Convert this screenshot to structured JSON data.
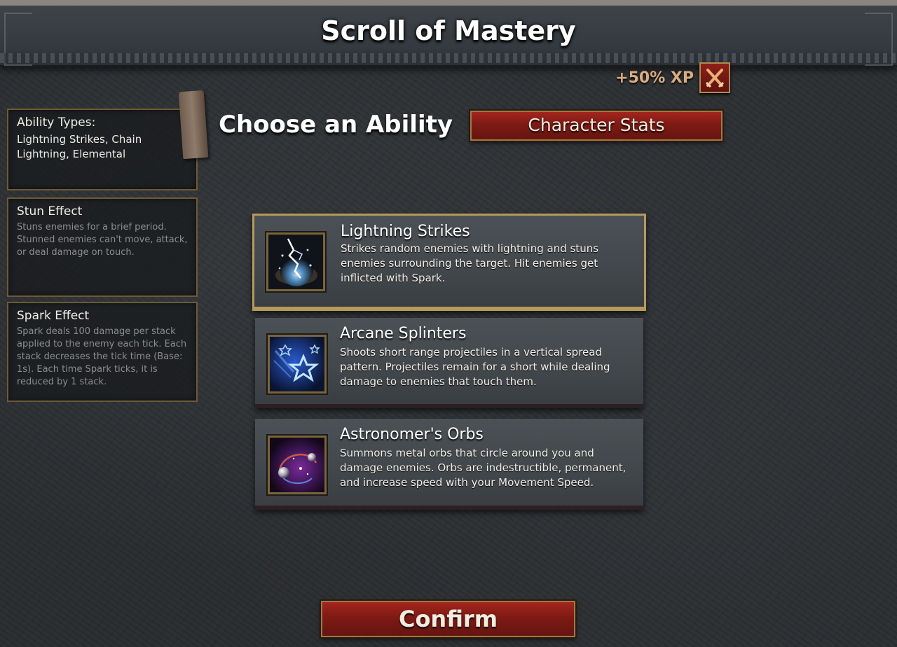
{
  "header": {
    "title": "Scroll of Mastery"
  },
  "xp_bonus": {
    "label": "+50% XP",
    "icon": "crossed-swords-icon"
  },
  "sidebar": {
    "ability_types": {
      "title": "Ability Types:",
      "value": "Lightning Strikes, Chain Lightning, Elemental"
    },
    "stun_effect": {
      "title": "Stun Effect",
      "description": "Stuns enemies for a brief period. Stunned enemies can't move, attack, or deal damage on touch."
    },
    "spark_effect": {
      "title": "Spark Effect",
      "description": "Spark deals 100 damage per stack applied to the enemy each tick. Each stack decreases the tick time (Base: 1s). Each time Spark ticks, it is reduced by 1 stack."
    }
  },
  "main": {
    "heading": "Choose an Ability",
    "stats_button_label": "Character Stats",
    "abilities": [
      {
        "name": "Lightning Strikes",
        "description": "Strikes random enemies with lightning and stuns enemies surrounding the target. Hit enemies get inflicted with Spark.",
        "icon": "lightning-strike-icon",
        "selected": true
      },
      {
        "name": "Arcane Splinters",
        "description": "Shoots short range projectiles in a vertical spread pattern. Projectiles remain for a short while dealing damage to enemies that touch them.",
        "icon": "arcane-splinters-icon",
        "selected": false
      },
      {
        "name": "Astronomer's Orbs",
        "description": "Summons metal orbs that circle around you and damage enemies. Orbs are indestructible, permanent, and increase speed with your Movement Speed.",
        "icon": "astronomer-orbs-icon",
        "selected": false
      }
    ],
    "confirm_label": "Confirm"
  },
  "colors": {
    "accent_red": "#8e2018",
    "gold_border": "#b59a5a",
    "xp_text": "#d8ad80"
  }
}
